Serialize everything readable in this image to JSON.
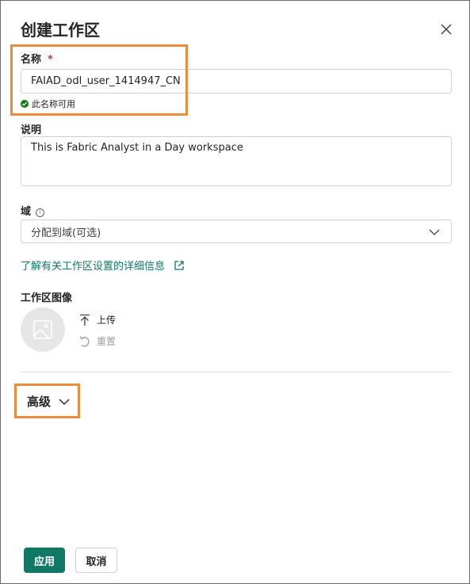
{
  "dialog": {
    "title": "创建工作区",
    "name_label": "名称",
    "required_mark": "*",
    "name_value": "FAIAD_odl_user_1414947_CN",
    "name_status": "此名称可用",
    "description_label": "说明",
    "description_value": "This is Fabric Analyst in a Day workspace",
    "domain_label": "域",
    "domain_placeholder": "分配到域(可选)",
    "learn_more_link": "了解有关工作区设置的详细信息",
    "image_label": "工作区图像",
    "upload_label": "上传",
    "reset_label": "重置",
    "advanced_label": "高级",
    "apply_button": "应用",
    "cancel_button": "取消"
  },
  "colors": {
    "accent": "#117865",
    "highlight": "#ec8c3c",
    "success": "#107c10",
    "required": "#c4314b"
  },
  "icons": [
    "close-icon",
    "check-icon",
    "info-icon",
    "chevron-down-icon",
    "open-external-icon",
    "image-placeholder-icon",
    "upload-icon",
    "reset-icon"
  ]
}
